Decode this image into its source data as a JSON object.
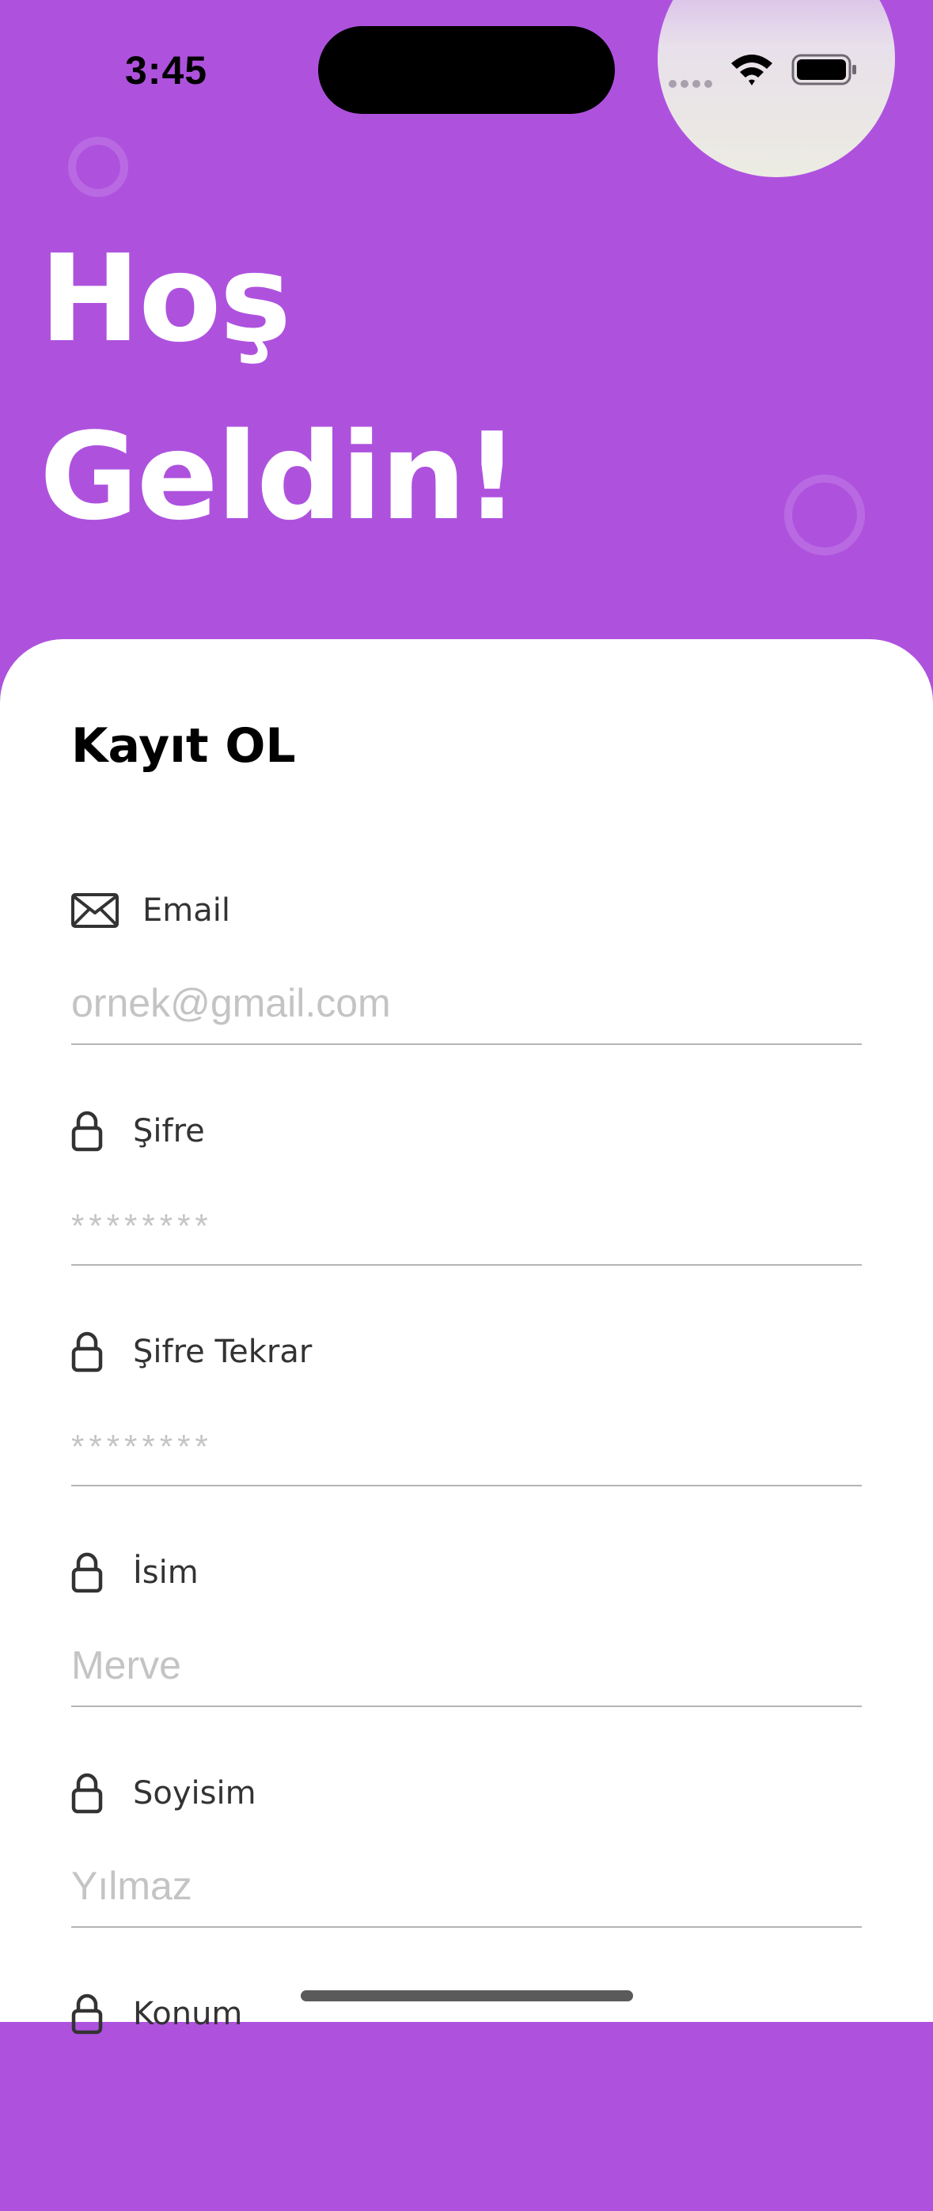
{
  "status_bar": {
    "time": "3:45",
    "icons": [
      "signal-icon",
      "wifi-icon",
      "battery-icon"
    ]
  },
  "header": {
    "welcome_line1": "Hoş",
    "welcome_line2": "Geldin!"
  },
  "form": {
    "title": "Kayıt OL",
    "fields": [
      {
        "icon": "mail-icon",
        "label": "Email",
        "placeholder": "ornek@gmail.com",
        "value": ""
      },
      {
        "icon": "lock-icon",
        "label": "Şifre",
        "placeholder": "********",
        "value": ""
      },
      {
        "icon": "lock-icon",
        "label": "Şifre Tekrar",
        "placeholder": "********",
        "value": ""
      },
      {
        "icon": "lock-icon",
        "label": "İsim",
        "placeholder": "Merve",
        "value": ""
      },
      {
        "icon": "lock-icon",
        "label": "Soyisim",
        "placeholder": "Yılmaz",
        "value": ""
      },
      {
        "icon": "lock-icon",
        "label": "Konum",
        "placeholder": "",
        "value": ""
      }
    ]
  },
  "colors": {
    "header_background": "#AE52DE",
    "card_background": "#FFFFFF",
    "text": "#333333",
    "placeholder": "#C4C4C4"
  }
}
